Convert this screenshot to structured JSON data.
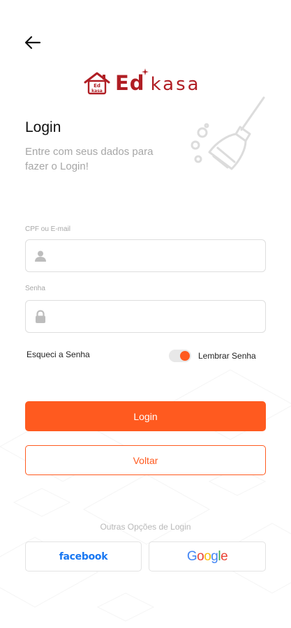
{
  "brand": {
    "logo_text": "Ed",
    "logo_text_2": "kasa",
    "house_badge": "Ed kasa",
    "color": "#b01e24"
  },
  "header": {
    "back_icon": "arrow-left-icon"
  },
  "intro": {
    "title": "Login",
    "subtitle": "Entre com seus dados para fazer o Login!"
  },
  "form": {
    "user_label": "CPF ou E-mail",
    "user_value": "",
    "user_icon": "user-icon",
    "password_label": "Senha",
    "password_value": "",
    "password_icon": "lock-icon",
    "forgot_label": "Esqueci a Senha",
    "remember_label": "Lembrar Senha",
    "remember_on": true
  },
  "actions": {
    "login_label": "Login",
    "back_label": "Voltar",
    "accent": "#ff5a1f"
  },
  "social": {
    "heading": "Outras Opções de Login",
    "facebook_label": "facebook",
    "google_label": "Google"
  }
}
